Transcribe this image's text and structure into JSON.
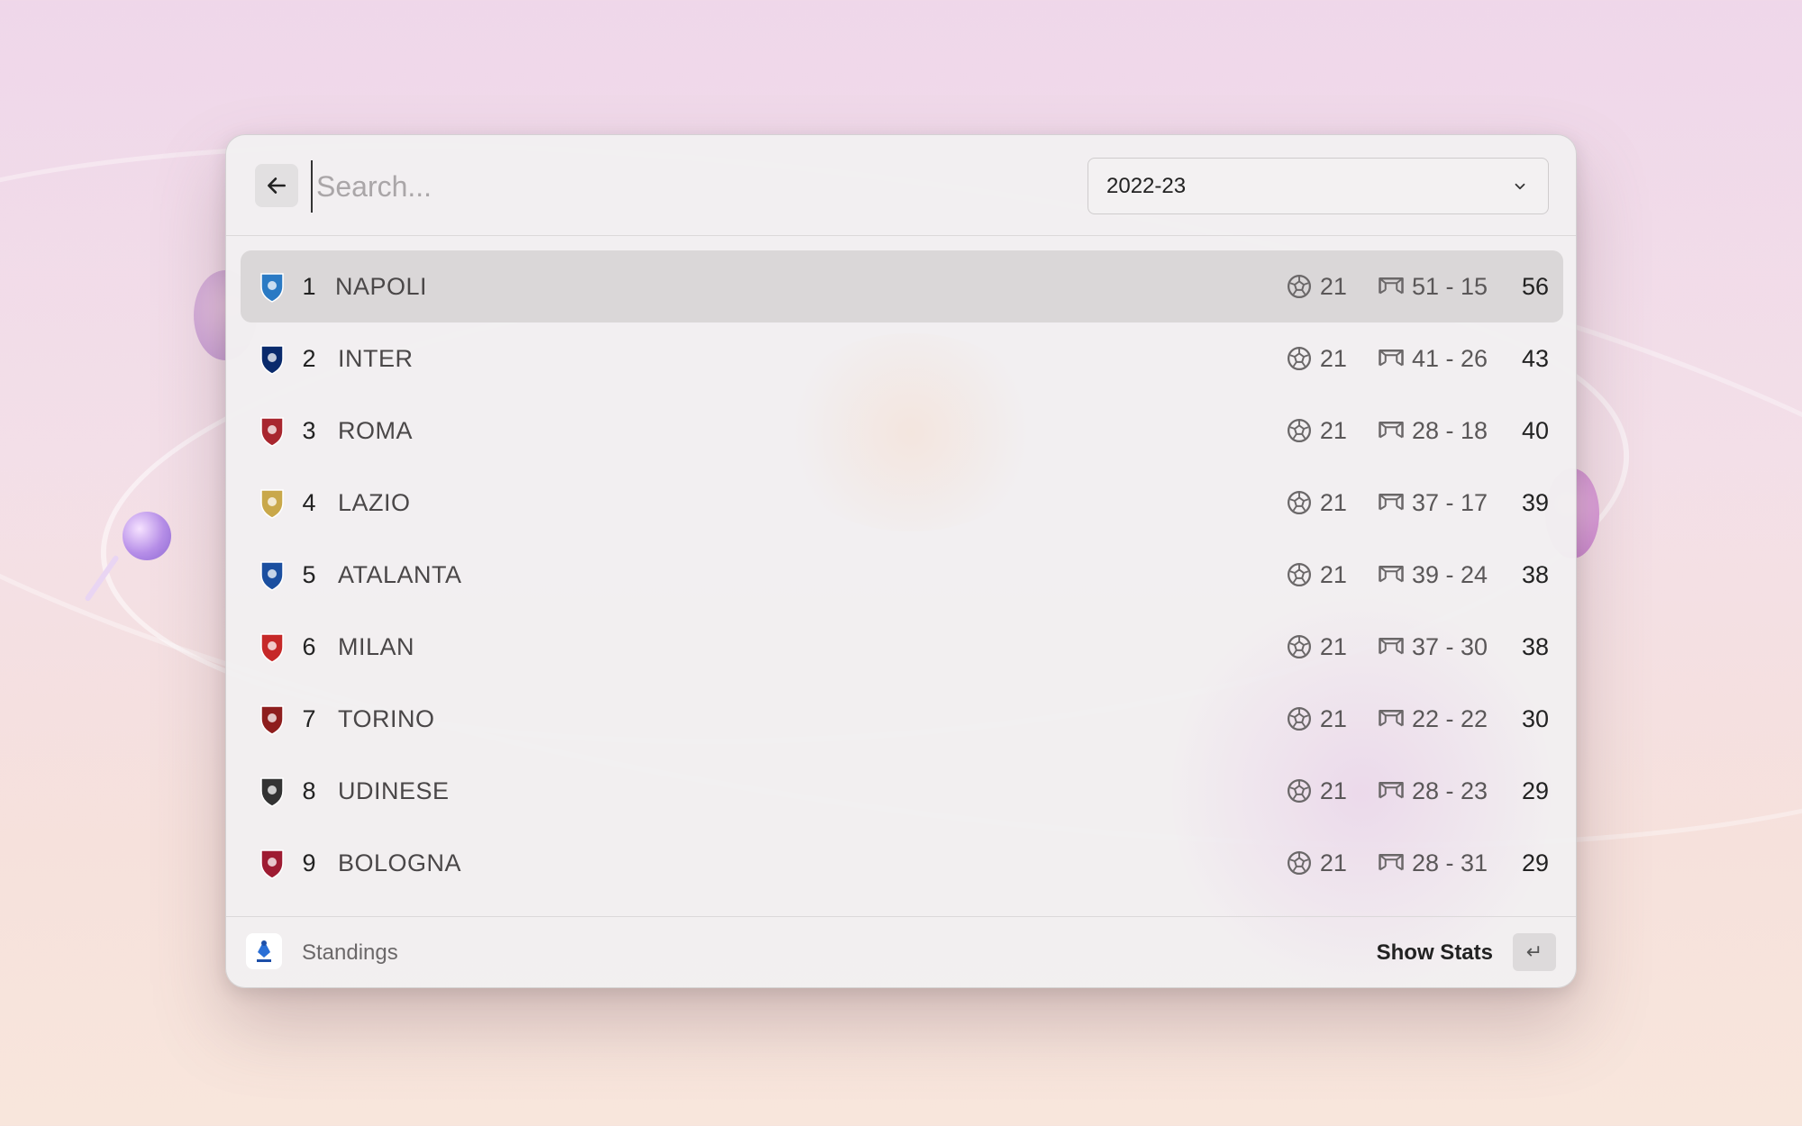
{
  "search": {
    "placeholder": "Search..."
  },
  "season_select": {
    "value": "2022-23"
  },
  "standings": [
    {
      "rank": "1",
      "team": "NAPOLI",
      "played": "21",
      "goals": "51 - 15",
      "points": "56",
      "crest": "napoli-crest",
      "color": "#2a7ac4",
      "selected": true
    },
    {
      "rank": "2",
      "team": "INTER",
      "played": "21",
      "goals": "41 - 26",
      "points": "43",
      "crest": "inter-crest",
      "color": "#0a2a6c"
    },
    {
      "rank": "3",
      "team": "ROMA",
      "played": "21",
      "goals": "28 - 18",
      "points": "40",
      "crest": "roma-crest",
      "color": "#a8262f"
    },
    {
      "rank": "4",
      "team": "LAZIO",
      "played": "21",
      "goals": "37 - 17",
      "points": "39",
      "crest": "lazio-crest",
      "color": "#c9a84a"
    },
    {
      "rank": "5",
      "team": "ATALANTA",
      "played": "21",
      "goals": "39 - 24",
      "points": "38",
      "crest": "atalanta-crest",
      "color": "#1b4fa0"
    },
    {
      "rank": "6",
      "team": "MILAN",
      "played": "21",
      "goals": "37 - 30",
      "points": "38",
      "crest": "milan-crest",
      "color": "#c62828"
    },
    {
      "rank": "7",
      "team": "TORINO",
      "played": "21",
      "goals": "22 - 22",
      "points": "30",
      "crest": "torino-crest",
      "color": "#8e1e1e"
    },
    {
      "rank": "8",
      "team": "UDINESE",
      "played": "21",
      "goals": "28 - 23",
      "points": "29",
      "crest": "udinese-crest",
      "color": "#333333"
    },
    {
      "rank": "9",
      "team": "BOLOGNA",
      "played": "21",
      "goals": "28 - 31",
      "points": "29",
      "crest": "bologna-crest",
      "color": "#9e1b32"
    }
  ],
  "footer": {
    "title": "Standings",
    "action": "Show Stats",
    "enter_key": "↵",
    "logo_icon": "serie-a-logo-icon"
  },
  "icons": {
    "back": "arrow-left-icon",
    "dropdown": "chevron-down-icon",
    "played": "soccer-ball-icon",
    "goals": "goal-net-icon"
  }
}
